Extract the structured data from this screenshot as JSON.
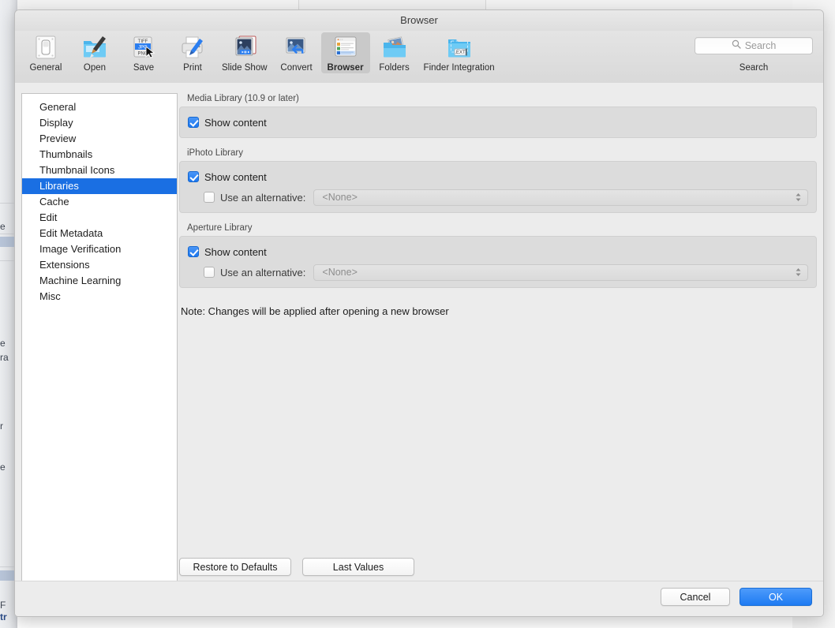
{
  "window": {
    "title": "Browser"
  },
  "toolbar": {
    "items": [
      {
        "label": "General",
        "icon": "switch-panel-icon",
        "selected": false
      },
      {
        "label": "Open",
        "icon": "folder-brush-icon",
        "selected": false
      },
      {
        "label": "Save",
        "icon": "file-format-list-icon",
        "selected": false
      },
      {
        "label": "Print",
        "icon": "printer-icon",
        "selected": false
      },
      {
        "label": "Slide Show",
        "icon": "slideshow-icon",
        "selected": false
      },
      {
        "label": "Convert",
        "icon": "convert-arrow-icon",
        "selected": false
      },
      {
        "label": "Browser",
        "icon": "browser-list-icon",
        "selected": true
      },
      {
        "label": "Folders",
        "icon": "folder-photos-icon",
        "selected": false
      },
      {
        "label": "Finder Integration",
        "icon": "folder-ext-icon",
        "selected": false
      }
    ],
    "save_icon_labels": [
      "TIFF",
      "JPG",
      "PNG"
    ],
    "finder_ext_label": ".EXT",
    "search": {
      "placeholder": "Search",
      "value": "",
      "label": "Search",
      "icon": "search-icon"
    }
  },
  "sidebar": {
    "items": [
      {
        "label": "General",
        "selected": false
      },
      {
        "label": "Display",
        "selected": false
      },
      {
        "label": "Preview",
        "selected": false
      },
      {
        "label": "Thumbnails",
        "selected": false
      },
      {
        "label": "Thumbnail Icons",
        "selected": false
      },
      {
        "label": "Libraries",
        "selected": true
      },
      {
        "label": "Cache",
        "selected": false
      },
      {
        "label": "Edit",
        "selected": false
      },
      {
        "label": "Edit Metadata",
        "selected": false
      },
      {
        "label": "Image Verification",
        "selected": false
      },
      {
        "label": "Extensions",
        "selected": false
      },
      {
        "label": "Machine Learning",
        "selected": false
      },
      {
        "label": "Misc",
        "selected": false
      }
    ]
  },
  "content": {
    "groups": [
      {
        "title": "Media Library (10.9 or later)",
        "show_content": {
          "label": "Show content",
          "checked": true
        },
        "alternative": null
      },
      {
        "title": "iPhoto Library",
        "show_content": {
          "label": "Show content",
          "checked": true
        },
        "alternative": {
          "label": "Use an alternative:",
          "checked": false,
          "value": "<None>"
        }
      },
      {
        "title": "Aperture Library",
        "show_content": {
          "label": "Show content",
          "checked": true
        },
        "alternative": {
          "label": "Use an alternative:",
          "checked": false,
          "value": "<None>"
        }
      }
    ],
    "note": "Note: Changes will be applied after opening a new browser",
    "restore_button": "Restore to Defaults",
    "last_values_button": "Last Values"
  },
  "footer": {
    "cancel_button": "Cancel",
    "ok_button": "OK"
  },
  "background": {
    "fragments": [
      "e",
      "e",
      "ra",
      "r",
      "e",
      "F",
      "tr"
    ]
  },
  "colors": {
    "accent": "#1a6fe3",
    "checkbox_on": "#1c77ef",
    "primary_button": "#1e7bf2",
    "window_bg": "#ececec",
    "group_bg": "#dcdcdc"
  }
}
